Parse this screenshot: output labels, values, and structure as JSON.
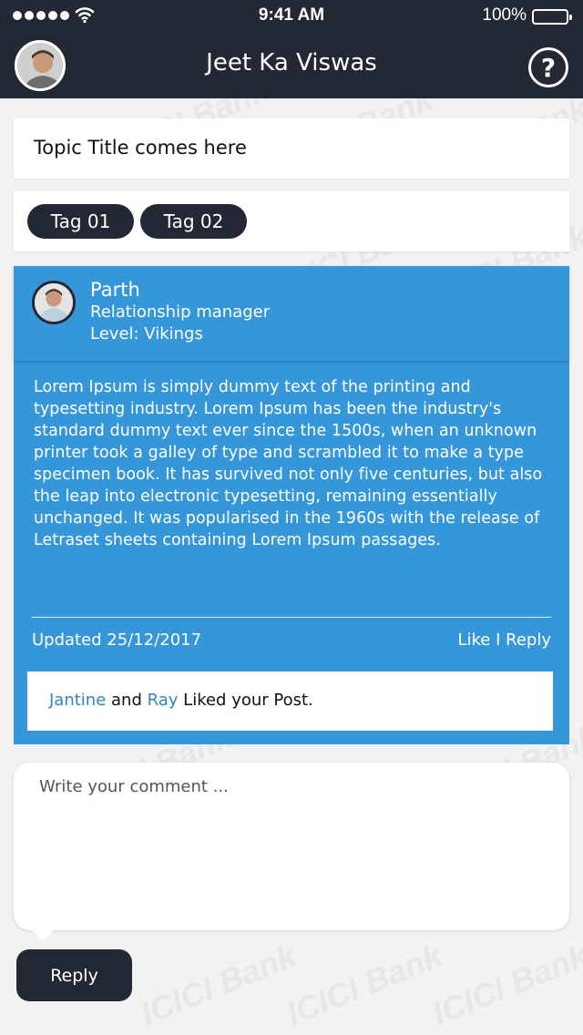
{
  "status_bar": {
    "time": "9:41 AM",
    "battery": "100%"
  },
  "header": {
    "title": "Jeet Ka Viswas",
    "help_symbol": "?"
  },
  "topic": {
    "title": "Topic Title comes here"
  },
  "tags": [
    "Tag 01",
    "Tag 02"
  ],
  "post": {
    "author": {
      "name": "Parth",
      "role": "Relationship manager",
      "level": "Level: Vikings"
    },
    "body": "Lorem Ipsum is simply dummy text of the printing and typesetting industry. Lorem Ipsum has been the industry's standard dummy text ever since the 1500s, when an unknown printer took a galley of type and scrambled it to make a type specimen book. It has survived not only five centuries, but also the leap into electronic typesetting, remaining essentially unchanged. It was popularised in the 1960s with the release of Letraset sheets containing Lorem Ipsum passages.",
    "updated": "Updated 25/12/2017",
    "like_label": "Like",
    "separator": "I",
    "reply_label": "Reply",
    "likes": {
      "user1": "Jantine",
      "and": "and",
      "user2": "Ray",
      "suffix": "Liked your Post."
    }
  },
  "comment": {
    "placeholder": "Write your comment ..."
  },
  "reply_button": {
    "label": "Reply"
  },
  "watermark_text": "ICICI Bank",
  "colors": {
    "header_bg": "#232835",
    "post_bg": "#3597d9",
    "link": "#2d84c6",
    "tag_bg": "#232835"
  }
}
